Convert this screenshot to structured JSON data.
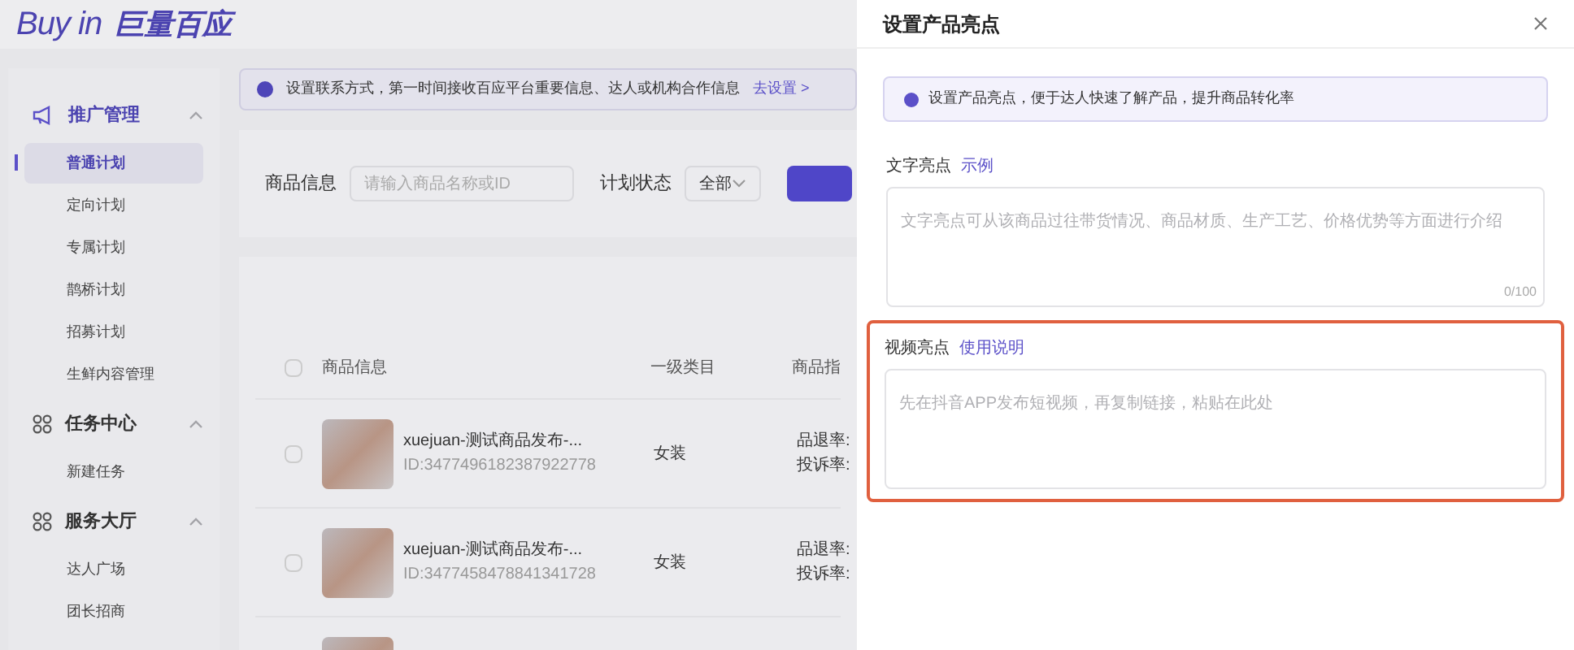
{
  "logo": {
    "latin": "Buy in",
    "chinese": "巨量百应"
  },
  "sidebar": [
    {
      "label": "推广管理",
      "kind": "megaphone",
      "expanded": true,
      "selected": true,
      "children": [
        {
          "label": "普通计划",
          "selected": true
        },
        {
          "label": "定向计划",
          "selected": false
        },
        {
          "label": "专属计划",
          "selected": false
        },
        {
          "label": "鹊桥计划",
          "selected": false
        },
        {
          "label": "招募计划",
          "selected": false
        },
        {
          "label": "生鲜内容管理",
          "selected": false
        }
      ]
    },
    {
      "label": "任务中心",
      "kind": "grid",
      "expanded": true,
      "selected": false,
      "children": [
        {
          "label": "新建任务",
          "selected": false
        }
      ]
    },
    {
      "label": "服务大厅",
      "kind": "grid",
      "expanded": true,
      "selected": false,
      "children": [
        {
          "label": "达人广场",
          "selected": false
        },
        {
          "label": "团长招商",
          "selected": false
        }
      ]
    }
  ],
  "notice": {
    "text": "设置联系方式，第一时间接收百应平台重要信息、达人或机构合作信息",
    "link": "去设置 >"
  },
  "filters": {
    "product_label": "商品信息",
    "product_placeholder": "请输入商品名称或ID",
    "status_label": "计划状态",
    "status_value": "全部"
  },
  "table": {
    "all_checked": false,
    "columns": [
      "商品信息",
      "一级类目",
      "商品指"
    ],
    "rows": [
      {
        "checked": false,
        "name": "xuejuan-测试商品发布-...",
        "id": "ID:3477496182387922778",
        "category": "女装",
        "metrics": [
          "品退率:",
          "投诉率:"
        ]
      },
      {
        "checked": false,
        "name": "xuejuan-测试商品发布-...",
        "id": "ID:3477458478841341728",
        "category": "女装",
        "metrics": [
          "品退率:",
          "投诉率:"
        ]
      },
      {}
    ]
  },
  "drawer": {
    "title": "设置产品亮点",
    "tip": "设置产品亮点，便于达人快速了解产品，提升商品转化率",
    "fields": [
      {
        "label": "文字亮点",
        "link": "示例",
        "placeholder": "文字亮点可从该商品过往带货情况、商品材质、生产工艺、价格优势等方面进行介绍",
        "counter": "0/100",
        "highlighted": false
      },
      {
        "label": "视频亮点",
        "link": "使用说明",
        "placeholder": "先在抖音APP发布短视频，再复制链接，粘贴在此处",
        "highlighted": true
      }
    ]
  }
}
